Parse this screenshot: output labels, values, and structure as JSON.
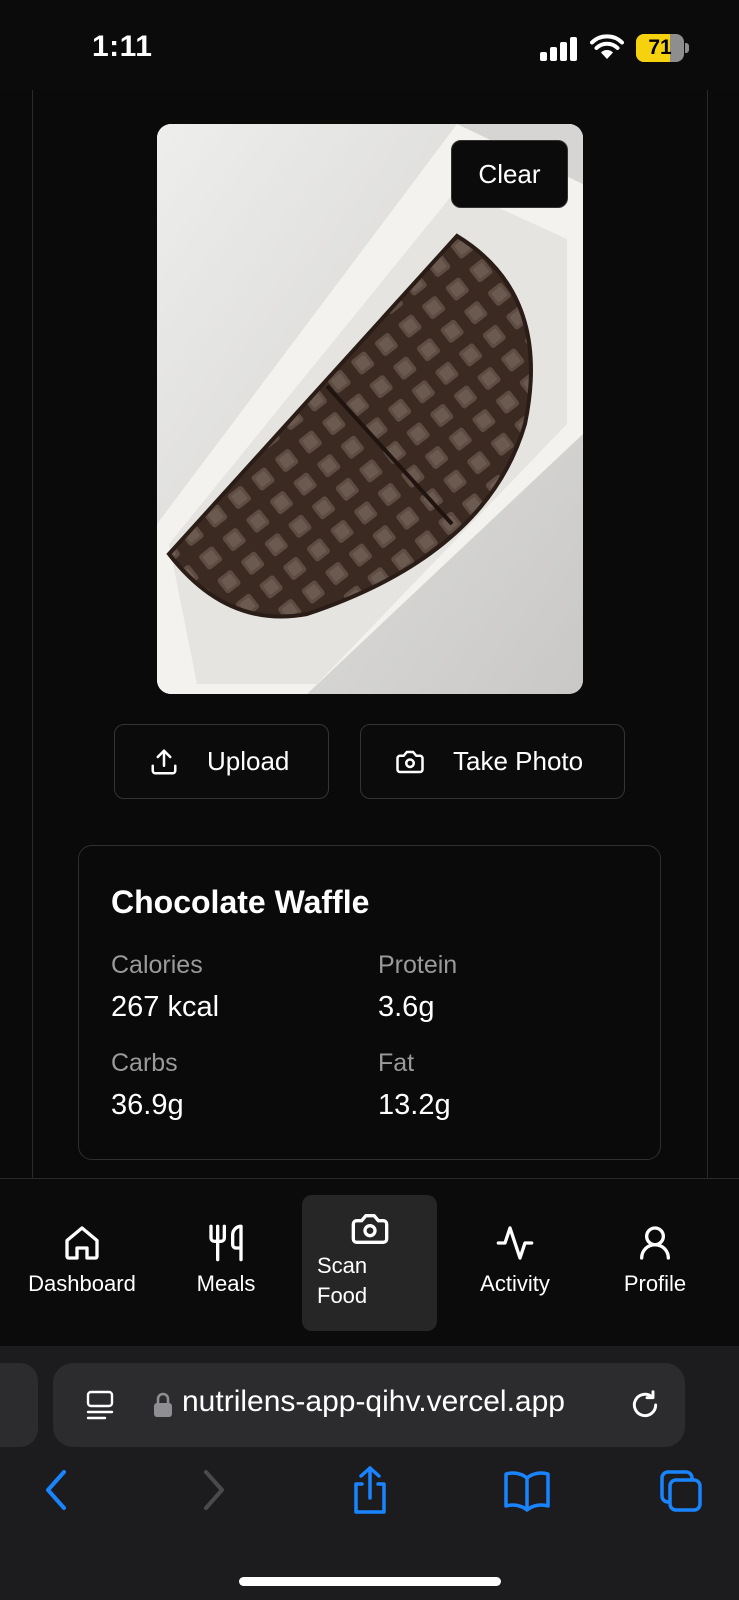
{
  "status_bar": {
    "time": "1:11",
    "battery_level": "71"
  },
  "scan": {
    "clear_label": "Clear",
    "upload_label": "Upload",
    "take_photo_label": "Take Photo"
  },
  "result": {
    "food_name": "Chocolate Waffle",
    "calories_label": "Calories",
    "calories_value": "267 kcal",
    "protein_label": "Protein",
    "protein_value": "3.6g",
    "carbs_label": "Carbs",
    "carbs_value": "36.9g",
    "fat_label": "Fat",
    "fat_value": "13.2g"
  },
  "nav": {
    "items": [
      {
        "label": "Dashboard",
        "icon": "home-icon"
      },
      {
        "label": "Meals",
        "icon": "utensils-icon"
      },
      {
        "label": "Scan Food",
        "icon": "camera-icon",
        "active": true
      },
      {
        "label": "Activity",
        "icon": "activity-icon"
      },
      {
        "label": "Profile",
        "icon": "user-icon"
      }
    ]
  },
  "browser": {
    "url": "nutrilens-app-qihv.vercel.app"
  },
  "colors": {
    "background": "#0a0a0a",
    "active_nav": "#262626",
    "ios_blue": "#1a84ff",
    "battery_yellow": "#f5d10e"
  }
}
